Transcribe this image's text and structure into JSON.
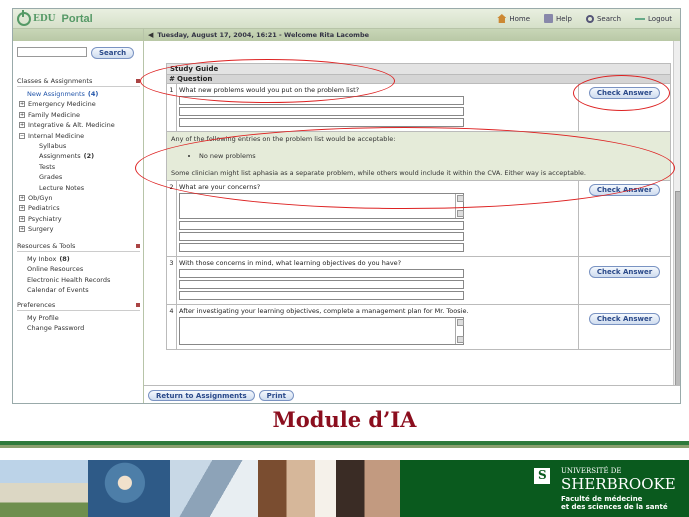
{
  "window": {
    "logo_edu": "EDU",
    "logo_portal": "Portal",
    "nav": {
      "home": "Home",
      "help": "Help",
      "search": "Search",
      "logout": "Logout"
    },
    "date_bar": "Tuesday, August 17, 2004, 16:21 - Welcome Rita Lacombe"
  },
  "sidebar": {
    "search_button": "Search",
    "classes_title": "Classes & Assignments",
    "classes": [
      {
        "label": "New Assignments",
        "count": "(4)",
        "level": "top",
        "active": true
      },
      {
        "label": "Emergency Medicine",
        "level": "tree"
      },
      {
        "label": "Family Medicine",
        "level": "tree"
      },
      {
        "label": "Integrative & Alt. Medicine",
        "level": "tree"
      },
      {
        "label": "Internal Medicine",
        "level": "tree-open"
      },
      {
        "label": "Syllabus",
        "level": "sub"
      },
      {
        "label": "Assignments",
        "count": "(2)",
        "level": "sub"
      },
      {
        "label": "Tests",
        "level": "sub"
      },
      {
        "label": "Grades",
        "level": "sub"
      },
      {
        "label": "Lecture Notes",
        "level": "sub"
      },
      {
        "label": "Ob/Gyn",
        "level": "tree"
      },
      {
        "label": "Pediatrics",
        "level": "tree"
      },
      {
        "label": "Psychiatry",
        "level": "tree"
      },
      {
        "label": "Surgery",
        "level": "tree"
      }
    ],
    "resources_title": "Resources & Tools",
    "resources": [
      {
        "label": "My Inbox",
        "count": "(8)"
      },
      {
        "label": "Online Resources"
      },
      {
        "label": "Electronic Health Records"
      },
      {
        "label": "Calendar of Events"
      }
    ],
    "preferences_title": "Preferences",
    "preferences": [
      {
        "label": "My Profile"
      },
      {
        "label": "Change Password"
      }
    ]
  },
  "guide": {
    "title": "Study Guide",
    "num_header": "#",
    "question_header": "Question",
    "check_label": "Check Answer",
    "q1": "What new problems would you put on the problem list?",
    "feedback_intro": "Any of the following entries on the problem list would be acceptable:",
    "feedback_item": "No new problems",
    "feedback_note": "Some clinician might list aphasia as a separate problem, while others would include it within the CVA. Either way is acceptable.",
    "q2": "What are your concerns?",
    "q3": "With those concerns in mind, what learning objectives do you have?",
    "q4": "After investigating your learning objectives, complete a management plan for Mr. Toosie.",
    "n1": "1",
    "n2": "2",
    "n3": "3",
    "n4": "4",
    "return_button": "Return to Assignments",
    "print_button": "Print"
  },
  "slide": {
    "title": "Module d’IA",
    "logo_line1": "UNIVERSITÉ DE",
    "logo_line2": "SHERBROOKE",
    "logo_line3": "Faculté de médecine",
    "logo_line4": "et des sciences de la santé"
  },
  "colors": {
    "accent_red": "#d22222",
    "title_red": "#8b0e1e",
    "banner_green": "#0a5a1e",
    "link_blue": "#2255aa"
  }
}
